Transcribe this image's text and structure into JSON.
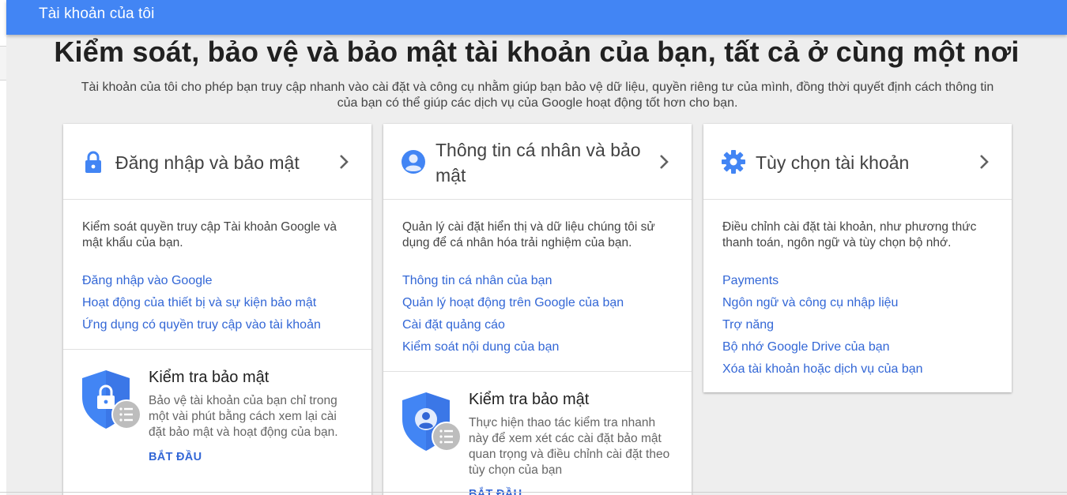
{
  "header": {
    "title": "Tài khoản của tôi"
  },
  "hero": {
    "title": "Kiểm soát, bảo vệ và bảo mật tài khoản của bạn, tất cả ở cùng một nơi",
    "description": "Tài khoản của tôi cho phép bạn truy cập nhanh vào cài đặt và công cụ nhằm giúp bạn bảo vệ dữ liệu, quyền riêng tư của mình, đồng thời quyết định cách thông tin của bạn có thể giúp các dịch vụ của Google hoạt động tốt hơn cho bạn."
  },
  "cards": [
    {
      "title": "Đăng nhập và bảo mật",
      "icon": "lock-icon",
      "description": "Kiểm soát quyền truy cập Tài khoản Google và mật khẩu của bạn.",
      "links": [
        "Đăng nhập vào Google",
        "Hoạt động của thiết bị và sự kiện bảo mật",
        "Ứng dụng có quyền truy cập vào tài khoản"
      ],
      "checkup": {
        "title": "Kiểm tra bảo mật",
        "text": "Bảo vệ tài khoản của bạn chỉ trong một vài phút bằng cách xem lại cài đặt bảo mật và hoạt động của bạn.",
        "action": "BẮT ĐẦU"
      }
    },
    {
      "title": "Thông tin cá nhân và bảo mật",
      "icon": "person-icon",
      "description": "Quản lý cài đặt hiển thị và dữ liệu chúng tôi sử dụng để cá nhân hóa trải nghiệm của bạn.",
      "links": [
        "Thông tin cá nhân của bạn",
        "Quản lý hoạt động trên Google của bạn",
        "Cài đặt quảng cáo",
        "Kiểm soát nội dung của bạn"
      ],
      "checkup": {
        "title": "Kiểm tra bảo mật",
        "text": "Thực hiện thao tác kiểm tra nhanh này để xem xét các cài đặt bảo mật quan trọng và điều chỉnh cài đặt theo tùy chọn của bạn",
        "action": "BẮT ĐẦU"
      }
    },
    {
      "title": "Tùy chọn tài khoản",
      "icon": "gear-icon",
      "description": "Điều chỉnh cài đặt tài khoản, như phương thức thanh toán, ngôn ngữ và tùy chọn bộ nhớ.",
      "links": [
        "Payments",
        "Ngôn ngữ và công cụ nhập liệu",
        "Trợ năng",
        "Bộ nhớ Google Drive của bạn",
        "Xóa tài khoản hoặc dịch vụ của bạn"
      ]
    }
  ],
  "colors": {
    "brand": "#4285f4",
    "link": "#3367d6",
    "shield": "#4285f4",
    "badge": "#bdbdbd"
  }
}
